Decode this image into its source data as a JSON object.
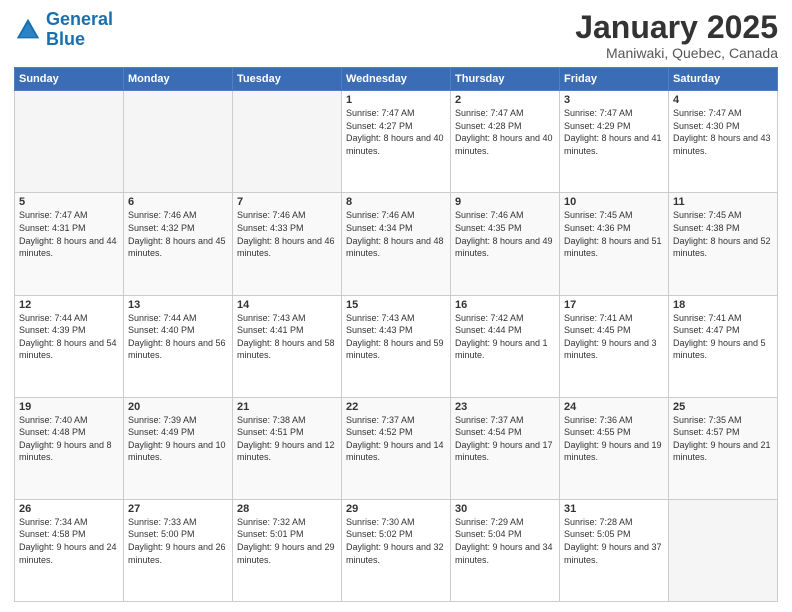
{
  "logo": {
    "line1": "General",
    "line2": "Blue"
  },
  "header": {
    "title": "January 2025",
    "subtitle": "Maniwaki, Quebec, Canada"
  },
  "weekdays": [
    "Sunday",
    "Monday",
    "Tuesday",
    "Wednesday",
    "Thursday",
    "Friday",
    "Saturday"
  ],
  "weeks": [
    [
      {
        "day": "",
        "empty": true
      },
      {
        "day": "",
        "empty": true
      },
      {
        "day": "",
        "empty": true
      },
      {
        "day": "1",
        "sunrise": "7:47 AM",
        "sunset": "4:27 PM",
        "daylight": "8 hours and 40 minutes."
      },
      {
        "day": "2",
        "sunrise": "7:47 AM",
        "sunset": "4:28 PM",
        "daylight": "8 hours and 40 minutes."
      },
      {
        "day": "3",
        "sunrise": "7:47 AM",
        "sunset": "4:29 PM",
        "daylight": "8 hours and 41 minutes."
      },
      {
        "day": "4",
        "sunrise": "7:47 AM",
        "sunset": "4:30 PM",
        "daylight": "8 hours and 43 minutes."
      }
    ],
    [
      {
        "day": "5",
        "sunrise": "7:47 AM",
        "sunset": "4:31 PM",
        "daylight": "8 hours and 44 minutes."
      },
      {
        "day": "6",
        "sunrise": "7:46 AM",
        "sunset": "4:32 PM",
        "daylight": "8 hours and 45 minutes."
      },
      {
        "day": "7",
        "sunrise": "7:46 AM",
        "sunset": "4:33 PM",
        "daylight": "8 hours and 46 minutes."
      },
      {
        "day": "8",
        "sunrise": "7:46 AM",
        "sunset": "4:34 PM",
        "daylight": "8 hours and 48 minutes."
      },
      {
        "day": "9",
        "sunrise": "7:46 AM",
        "sunset": "4:35 PM",
        "daylight": "8 hours and 49 minutes."
      },
      {
        "day": "10",
        "sunrise": "7:45 AM",
        "sunset": "4:36 PM",
        "daylight": "8 hours and 51 minutes."
      },
      {
        "day": "11",
        "sunrise": "7:45 AM",
        "sunset": "4:38 PM",
        "daylight": "8 hours and 52 minutes."
      }
    ],
    [
      {
        "day": "12",
        "sunrise": "7:44 AM",
        "sunset": "4:39 PM",
        "daylight": "8 hours and 54 minutes."
      },
      {
        "day": "13",
        "sunrise": "7:44 AM",
        "sunset": "4:40 PM",
        "daylight": "8 hours and 56 minutes."
      },
      {
        "day": "14",
        "sunrise": "7:43 AM",
        "sunset": "4:41 PM",
        "daylight": "8 hours and 58 minutes."
      },
      {
        "day": "15",
        "sunrise": "7:43 AM",
        "sunset": "4:43 PM",
        "daylight": "8 hours and 59 minutes."
      },
      {
        "day": "16",
        "sunrise": "7:42 AM",
        "sunset": "4:44 PM",
        "daylight": "9 hours and 1 minute."
      },
      {
        "day": "17",
        "sunrise": "7:41 AM",
        "sunset": "4:45 PM",
        "daylight": "9 hours and 3 minutes."
      },
      {
        "day": "18",
        "sunrise": "7:41 AM",
        "sunset": "4:47 PM",
        "daylight": "9 hours and 5 minutes."
      }
    ],
    [
      {
        "day": "19",
        "sunrise": "7:40 AM",
        "sunset": "4:48 PM",
        "daylight": "9 hours and 8 minutes."
      },
      {
        "day": "20",
        "sunrise": "7:39 AM",
        "sunset": "4:49 PM",
        "daylight": "9 hours and 10 minutes."
      },
      {
        "day": "21",
        "sunrise": "7:38 AM",
        "sunset": "4:51 PM",
        "daylight": "9 hours and 12 minutes."
      },
      {
        "day": "22",
        "sunrise": "7:37 AM",
        "sunset": "4:52 PM",
        "daylight": "9 hours and 14 minutes."
      },
      {
        "day": "23",
        "sunrise": "7:37 AM",
        "sunset": "4:54 PM",
        "daylight": "9 hours and 17 minutes."
      },
      {
        "day": "24",
        "sunrise": "7:36 AM",
        "sunset": "4:55 PM",
        "daylight": "9 hours and 19 minutes."
      },
      {
        "day": "25",
        "sunrise": "7:35 AM",
        "sunset": "4:57 PM",
        "daylight": "9 hours and 21 minutes."
      }
    ],
    [
      {
        "day": "26",
        "sunrise": "7:34 AM",
        "sunset": "4:58 PM",
        "daylight": "9 hours and 24 minutes."
      },
      {
        "day": "27",
        "sunrise": "7:33 AM",
        "sunset": "5:00 PM",
        "daylight": "9 hours and 26 minutes."
      },
      {
        "day": "28",
        "sunrise": "7:32 AM",
        "sunset": "5:01 PM",
        "daylight": "9 hours and 29 minutes."
      },
      {
        "day": "29",
        "sunrise": "7:30 AM",
        "sunset": "5:02 PM",
        "daylight": "9 hours and 32 minutes."
      },
      {
        "day": "30",
        "sunrise": "7:29 AM",
        "sunset": "5:04 PM",
        "daylight": "9 hours and 34 minutes."
      },
      {
        "day": "31",
        "sunrise": "7:28 AM",
        "sunset": "5:05 PM",
        "daylight": "9 hours and 37 minutes."
      },
      {
        "day": "",
        "empty": true
      }
    ]
  ]
}
